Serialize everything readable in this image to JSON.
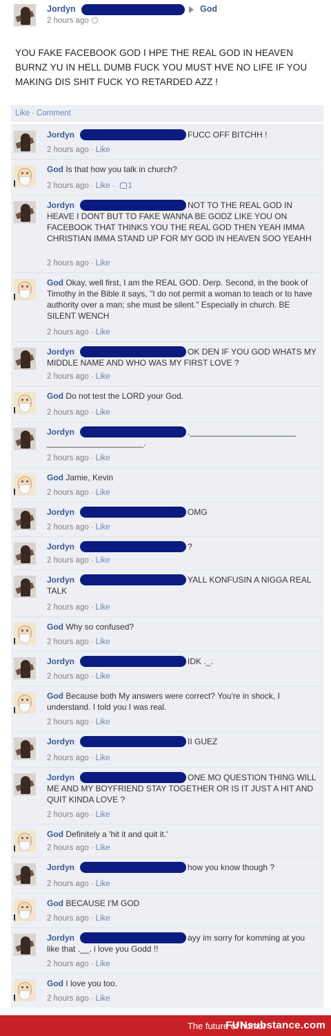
{
  "post": {
    "author": "Jordyn",
    "target": "God",
    "time": "2 hours ago",
    "status": "YOU FAKE FACEBOOK GOD I HPE THE REAL GOD IN HEAVEN BURNZ YU IN HELL DUMB FUCK YOU MUST HVE NO LIFE IF YOU MAKING DIS SHIT FUCK YO RETARDED AZZ !",
    "like_label": "Like",
    "comment_label": "Comment",
    "separator": "·"
  },
  "comments": [
    {
      "author": "Jordyn",
      "kind": "jordyn",
      "text": "FUCC OFF BITCHH !",
      "time": "2 hours ago",
      "like": "Like"
    },
    {
      "author": "God",
      "kind": "god",
      "text": "Is that how you talk in church?",
      "time": "2 hours ago",
      "like": "Like",
      "likes_count": "1"
    },
    {
      "author": "Jordyn",
      "kind": "jordyn",
      "text": "NOT TO THE REAL GOD IN HEAVE I DONT BUT TO FAKE WANNA BE GODZ LIKE YOU ON FACEBOOK THAT THINKS YOU THE REAL GOD THEN YEAH IMMA CHRISTIAN IMMA STAND UP FOR MY GOD IN HEAVEN SOO YEAHH",
      "time": "2 hours ago",
      "like": "Like"
    },
    {
      "author": "God",
      "kind": "god",
      "text": "Okay, well first, I am the REAL GOD. Derp. Second, in the book of Timothy in the Bible it says, \"I do not permit a woman to teach or to have authority over a man; she must be silent.\" Especially in church. BE SILENT WENCH",
      "time": "2 hours ago",
      "like": "Like"
    },
    {
      "author": "Jordyn",
      "kind": "jordyn",
      "text": "OK DEN IF YOU GOD WHATS MY MIDDLE NAME AND WHO WAS MY FIRST LOVE ?",
      "time": "2 hours ago",
      "like": "Like"
    },
    {
      "author": "God",
      "kind": "god",
      "text": "Do not test the LORD your God.",
      "time": "2 hours ago",
      "like": "Like"
    },
    {
      "author": "Jordyn",
      "kind": "jordyn",
      "text": "._______________________ _____________________.",
      "time": "2 hours ago",
      "like": "Like"
    },
    {
      "author": "God",
      "kind": "god",
      "text": "Jamie, Kevin",
      "time": "2 hours ago",
      "like": "Like"
    },
    {
      "author": "Jordyn",
      "kind": "jordyn",
      "text": "OMG",
      "time": "2 hours ago",
      "like": "Like"
    },
    {
      "author": "Jordyn",
      "kind": "jordyn",
      "text": "?",
      "time": "2 hours ago",
      "like": "Like"
    },
    {
      "author": "Jordyn",
      "kind": "jordyn",
      "text": "YALL KONFUSIN A NIGGA REAL TALK",
      "time": "2 hours ago",
      "like": "Like"
    },
    {
      "author": "God",
      "kind": "god",
      "text": "Why so confused?",
      "time": "2 hours ago",
      "like": "Like"
    },
    {
      "author": "Jordyn",
      "kind": "jordyn",
      "text": "IDK ._.",
      "time": "2 hours ago",
      "like": "Like"
    },
    {
      "author": "God",
      "kind": "god",
      "text": "Because both My answers were correct? You're in shock, I understand. I told you I was real.",
      "time": "2 hours ago",
      "like": "Like"
    },
    {
      "author": "Jordyn",
      "kind": "jordyn",
      "text": "II GUEZ",
      "time": "2 hours ago",
      "like": "Like"
    },
    {
      "author": "Jordyn",
      "kind": "jordyn",
      "text": "ONE MO QUESTION THING WILL ME AND MY BOYFRIEND STAY TOGETHER OR IS IT JUST A HIT AND QUIT KINDA LOVE ?",
      "time": "2 hours ago",
      "like": "Like"
    },
    {
      "author": "God",
      "kind": "god",
      "text": "Definitely a 'hit it and quit it.'",
      "time": "2 hours ago",
      "like": "Like"
    },
    {
      "author": "Jordyn",
      "kind": "jordyn",
      "text": "how you know though ?",
      "time": "2 hours ago",
      "like": "Like"
    },
    {
      "author": "God",
      "kind": "god",
      "text": "BECAUSE I'M GOD",
      "time": "2 hours ago",
      "like": "Like"
    },
    {
      "author": "Jordyn",
      "kind": "jordyn",
      "text": "ayy im sorry for komming at you like that .__. i love you Godd !!",
      "time": "2 hours ago",
      "like": "Like"
    },
    {
      "author": "God",
      "kind": "god",
      "text": "I love you too.",
      "time": "2 hours ago",
      "like": "Like"
    }
  ],
  "footer": {
    "tagline": "The future of humor",
    "brand": "FUNsubstance.com"
  }
}
